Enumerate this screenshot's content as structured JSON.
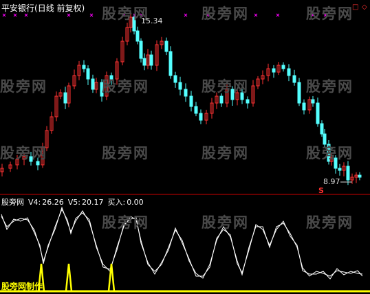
{
  "header": {
    "stock_name": "平安银行",
    "period": "(日线 前复权)"
  },
  "indicator": {
    "name": "股旁网",
    "v4_label": "V4:",
    "v4_value": "26.26",
    "v5_label": "V5:",
    "v5_value": "20.17",
    "buy_label": "买入:",
    "buy_value": "0.00"
  },
  "annotations": {
    "high": "15.34",
    "low": "8.97",
    "signal": "S"
  },
  "watermark": "股旁网",
  "footer_text": "股旁网制作",
  "colors": {
    "up_candle": "#ff3232",
    "down_candle": "#54ffff",
    "line_v4": "#ffffff",
    "line_v5": "#ffffff",
    "buy_signal": "#ffff00",
    "separator": "#cc0000",
    "cross_marker": "#ff00ff"
  },
  "controls": {
    "square_icon": "square-icon",
    "diamond_icon": "diamond-icon"
  }
}
